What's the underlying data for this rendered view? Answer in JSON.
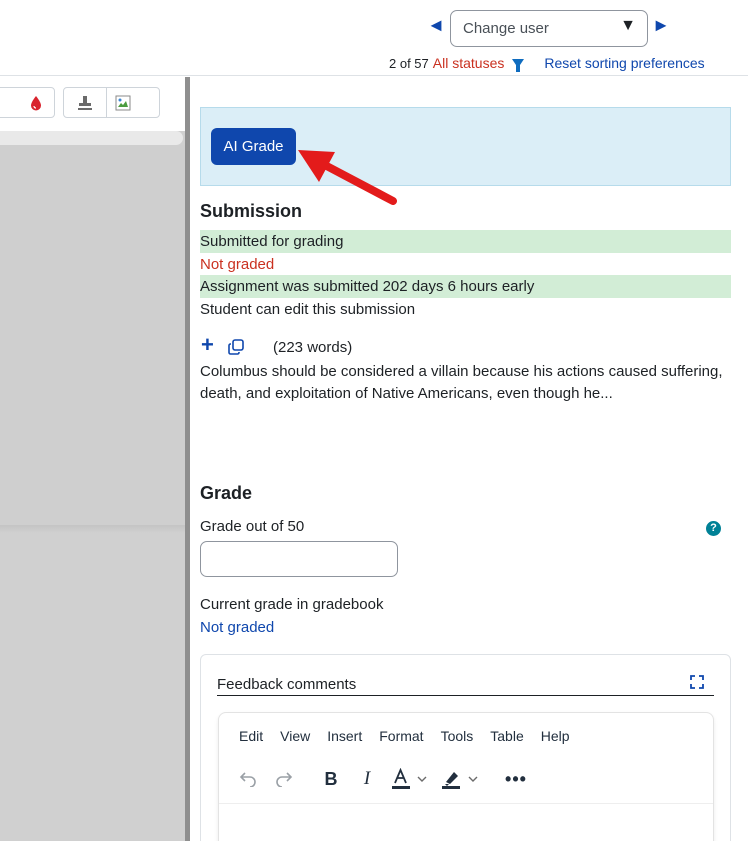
{
  "nav": {
    "prev_arrow": "◄",
    "next_arrow": "►",
    "user_select_value": "Change user",
    "user_select_caret": "▼",
    "counter": "2 of 57",
    "status_filter": "All statuses",
    "reset_sorting": "Reset sorting preferences"
  },
  "ai": {
    "button_label": "AI Grade",
    "arrow_color": "#e31b1b"
  },
  "submission": {
    "title": "Submission",
    "status_submitted": "Submitted for grading",
    "status_grading": "Not graded",
    "status_timing": "Assignment was submitted 202 days 6 hours early",
    "status_edit": "Student can edit this submission",
    "word_count": "(223 words)",
    "essay_preview": "Columbus should be considered a villain because his actions caused suffering, death, and exploitation of Native Americans, even though he..."
  },
  "grade": {
    "title": "Grade",
    "grade_out_of_label": "Grade out of 50",
    "grade_value": "",
    "gradebook_label": "Current grade in gradebook",
    "gradebook_value": "Not graded"
  },
  "feedback": {
    "label": "Feedback comments",
    "menu": [
      "Edit",
      "View",
      "Insert",
      "Format",
      "Tools",
      "Table",
      "Help"
    ]
  },
  "colors": {
    "primary": "#0f47ad",
    "danger": "#ca3120",
    "success_bg": "#d2edd6",
    "info_bg": "#dbeef7"
  }
}
